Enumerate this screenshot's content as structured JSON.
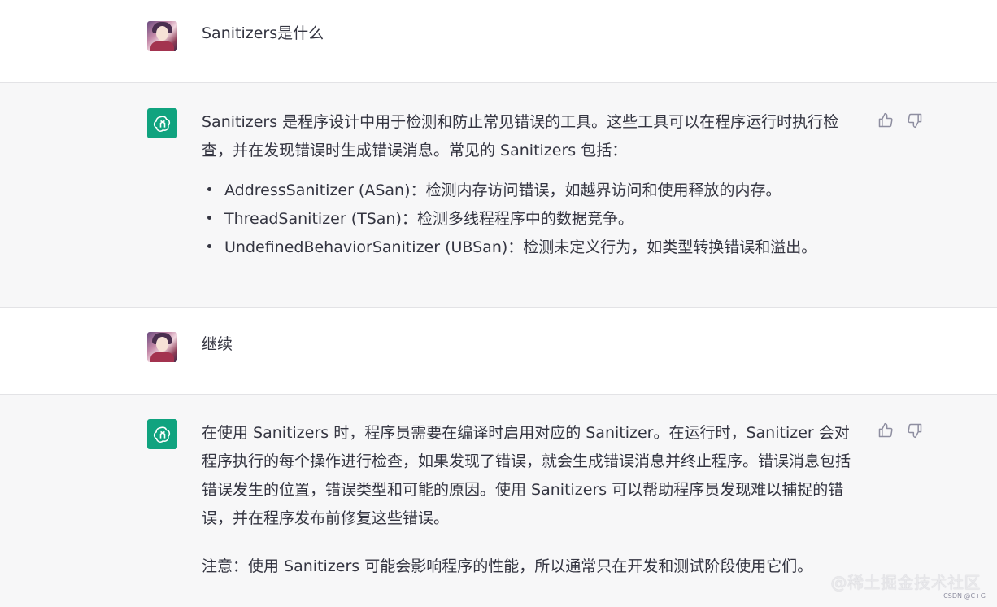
{
  "conversation": [
    {
      "role": "user",
      "text": "Sanitizers是什么"
    },
    {
      "role": "assistant",
      "paragraphs": [
        "Sanitizers 是程序设计中用于检测和防止常见错误的工具。这些工具可以在程序运行时执行检查，并在发现错误时生成错误消息。常见的 Sanitizers 包括："
      ],
      "list": [
        "AddressSanitizer (ASan)：检测内存访问错误，如越界访问和使用释放的内存。",
        "ThreadSanitizer (TSan)：检测多线程程序中的数据竞争。",
        "UndefinedBehaviorSanitizer (UBSan)：检测未定义行为，如类型转换错误和溢出。"
      ]
    },
    {
      "role": "user",
      "text": "继续"
    },
    {
      "role": "assistant",
      "paragraphs": [
        "在使用 Sanitizers 时，程序员需要在编译时启用对应的 Sanitizer。在运行时，Sanitizer 会对程序执行的每个操作进行检查，如果发现了错误，就会生成错误消息并终止程序。错误消息包括错误发生的位置，错误类型和可能的原因。使用 Sanitizers 可以帮助程序员发现难以捕捉的错误，并在程序发布前修复这些错误。",
        "注意：使用 Sanitizers 可能会影响程序的性能，所以通常只在开发和测试阶段使用它们。"
      ]
    }
  ],
  "icons": {
    "user_avatar": "user-avatar",
    "assistant_avatar": "openai-logo-icon",
    "thumbs_up": "thumbs-up-icon",
    "thumbs_down": "thumbs-down-icon"
  },
  "colors": {
    "assistant_bg": "#f7f7f8",
    "user_bg": "#ffffff",
    "gpt_logo_bg": "#10a37f",
    "text": "#343541"
  },
  "watermark": "@稀土掘金技术社区",
  "footer_mark": "CSDN @C+G"
}
